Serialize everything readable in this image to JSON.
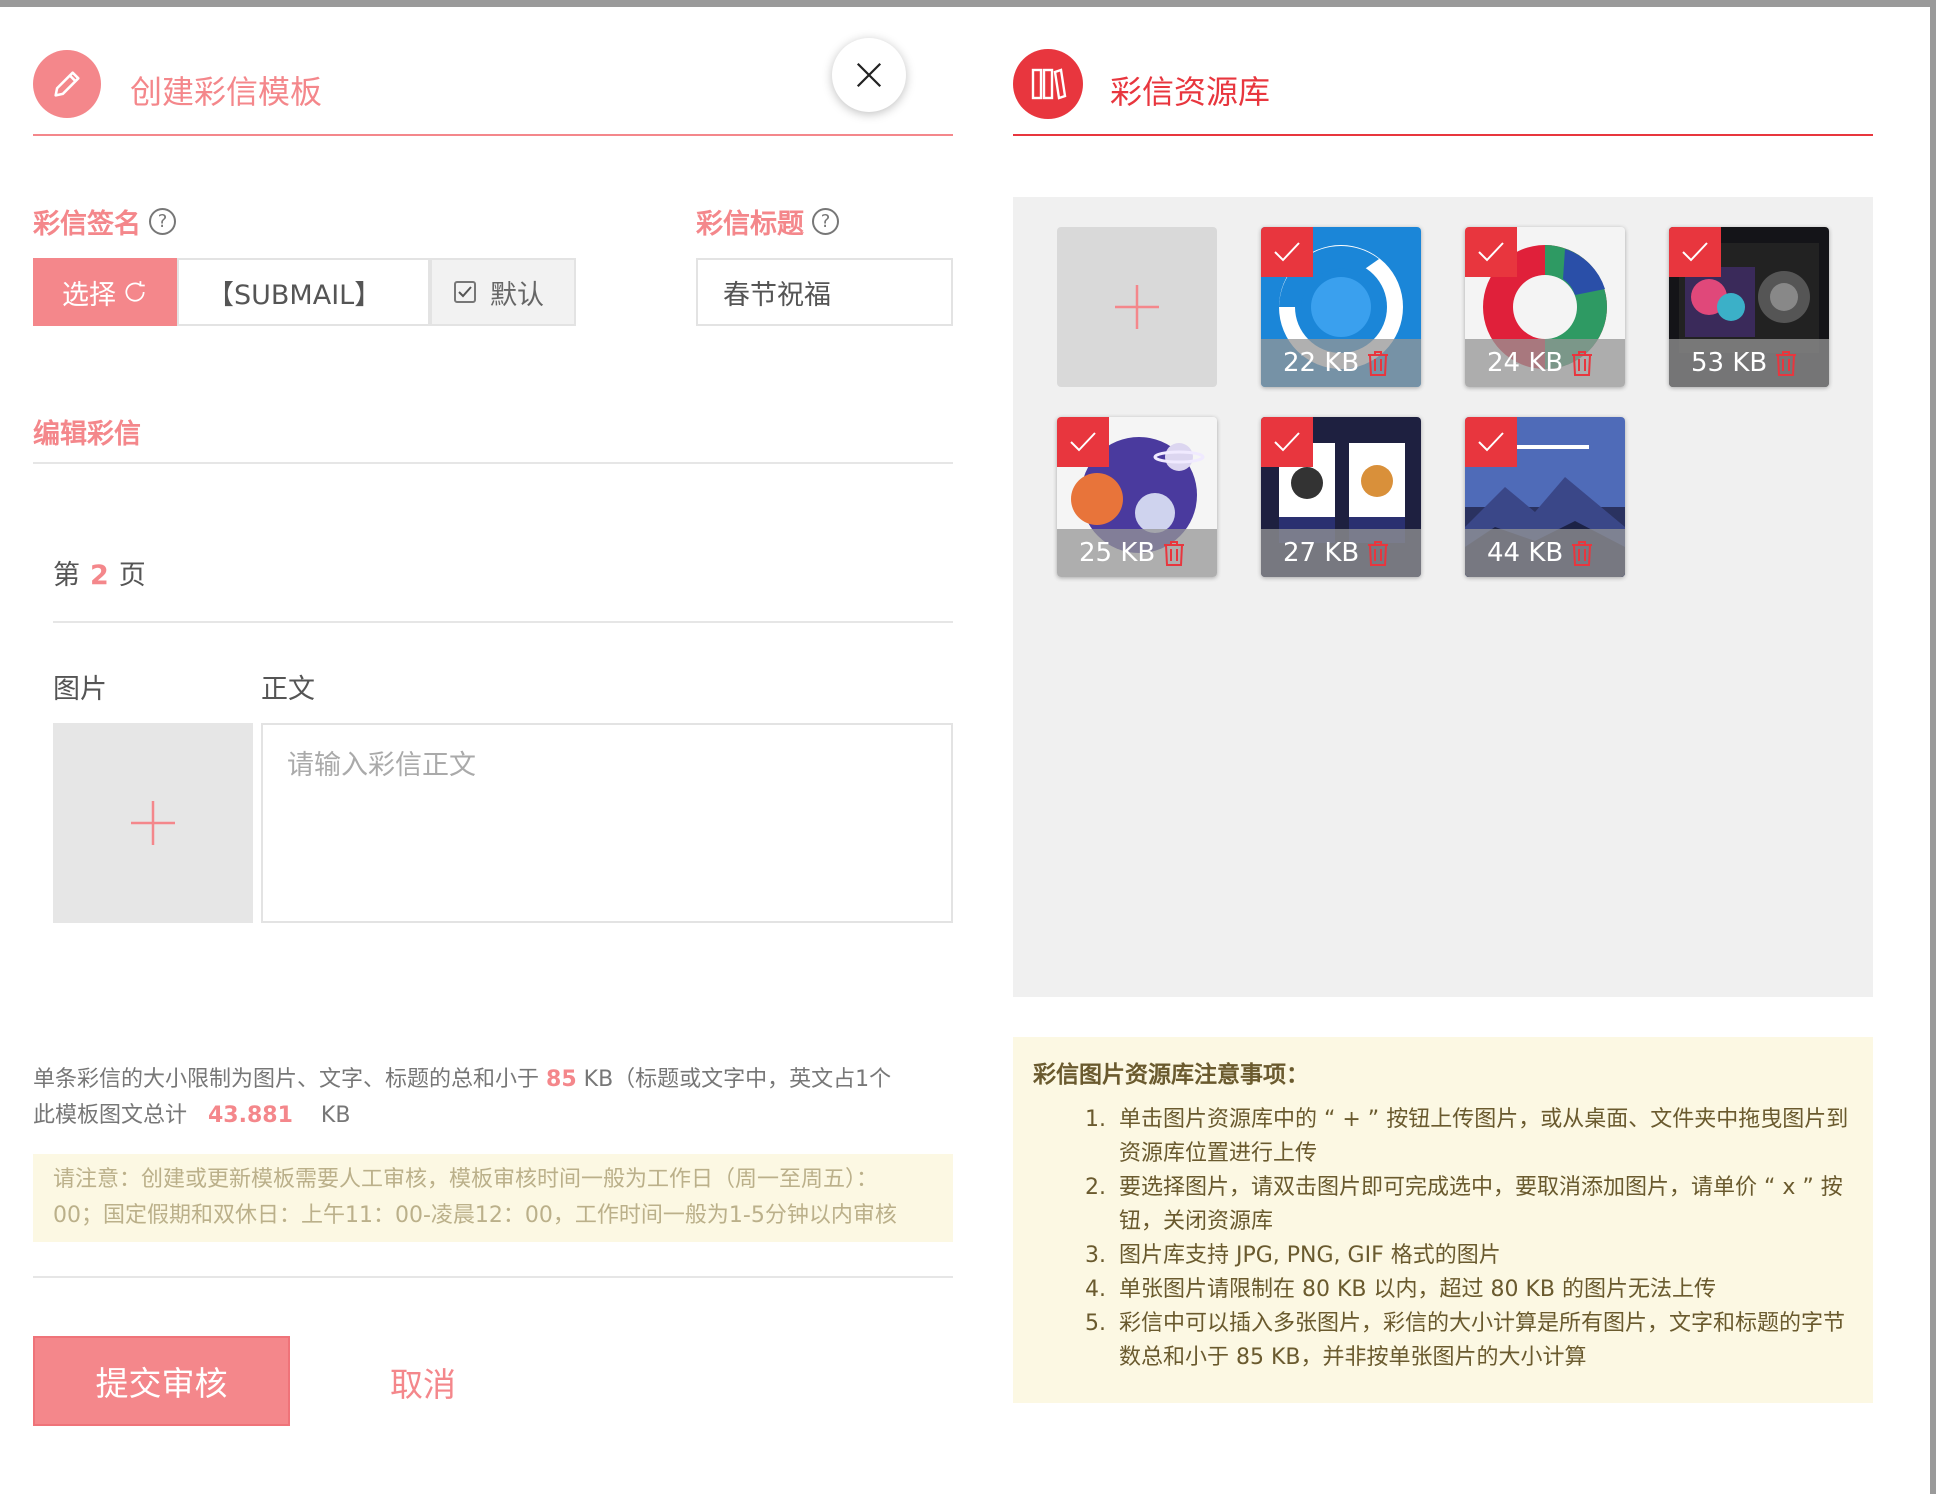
{
  "left": {
    "title": "创建彩信模板",
    "signature_label": "彩信签名",
    "subject_label": "彩信标题",
    "help_glyph": "?",
    "select_button": "选择",
    "signature_value": "【SUBMAIL】",
    "default_label": "默认",
    "subject_value": "春节祝福",
    "edit_section": "编辑彩信",
    "page_prefix": "第",
    "page_number": "2",
    "page_suffix": "页",
    "image_label": "图片",
    "body_label": "正文",
    "body_placeholder": "请输入彩信正文",
    "limit_text_1": "单条彩信的大小限制为图片、文字、标题的总和小于",
    "limit_value": "85",
    "limit_text_2": "KB（标题或文字中，英文占1个",
    "total_text_1": "此模板图文总计",
    "total_value": "43.881",
    "total_unit": "KB",
    "notice_line_1": "请注意：创建或更新模板需要人工审核，模板审核时间一般为工作日（周一至周五）：",
    "notice_line_2": "00；国定假期和双休日：上午11：00-凌晨12：00，工作时间一般为1-5分钟以内审核",
    "submit_button": "提交审核",
    "cancel_button": "取消"
  },
  "right": {
    "title": "彩信资源库",
    "images": [
      {
        "size": "22 KB"
      },
      {
        "size": "24 KB"
      },
      {
        "size": "53 KB"
      },
      {
        "size": "25 KB"
      },
      {
        "size": "27 KB"
      },
      {
        "size": "44 KB"
      }
    ],
    "tips_title": "彩信图片资源库注意事项：",
    "tips": [
      "单击图片资源库中的 “ + ” 按钮上传图片，或从桌面、文件夹中拖曳图片到资源库位置进行上传",
      "要选择图片，请双击图片即可完成选中，要取消添加图片，请单价 “ x ” 按钮，关闭资源库",
      "图片库支持 JPG, PNG, GIF 格式的图片",
      "单张图片请限制在 80 KB 以内，超过 80 KB 的图片无法上传",
      "彩信中可以插入多张图片，彩信的大小计算是所有图片，文字和标题的字节数总和小于 85 KB，并非按单张图片的大小计算"
    ]
  },
  "colors": {
    "accent_pink": "#f4878b",
    "accent_red": "#e8363e",
    "notice_bg": "#fcf8e3"
  },
  "icons": [
    "pencil-icon",
    "close-icon",
    "help-icon",
    "refresh-icon",
    "checkbox-icon",
    "plus-icon",
    "books-icon",
    "check-icon",
    "trash-icon"
  ]
}
